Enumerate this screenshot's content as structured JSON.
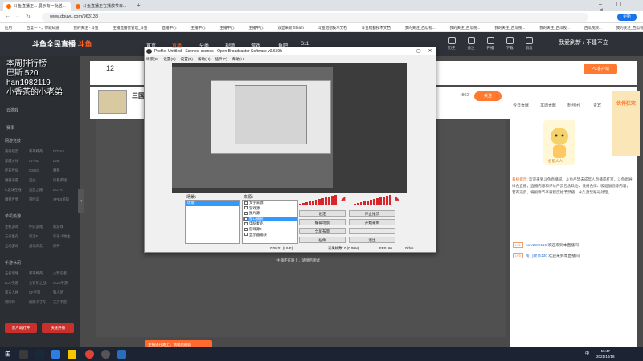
{
  "browser": {
    "tabs": [
      {
        "label": "斗鱼直播正... 展示有一批送..."
      },
      {
        "label": "斗鱼直播正在播放节目..."
      },
      {
        "label": "Steam"
      }
    ],
    "url": "www.douyu.com/963138",
    "update_label": "更新",
    "bookmarks": [
      "应用",
      "百度一下，你就知道",
      "我的关注 - 斗鱼",
      "主播直播营管理_斗鱼",
      "直播中心",
      "主播中心",
      "主播中心",
      "主播中心",
      "双显来斯 Steam",
      "斗鱼给勤技术文档",
      "斗鱼给勤技术文档",
      "我的关注_西瓜视...",
      "我的关注_西瓜视...",
      "我的关注_西瓜视...",
      "我的关注_西瓜视...",
      "西瓜视频...",
      "我的关注_西瓜视频",
      "其他书签"
    ]
  },
  "douyu": {
    "logo_main": "斗鱼全民直播",
    "logo_sub": "斗鱼",
    "nav": [
      "首页",
      "直播",
      "分类",
      "视频",
      "游戏",
      "鱼吧",
      "S11"
    ],
    "icons": [
      {
        "label": "历史",
        "icon": "clock-icon"
      },
      {
        "label": "关注",
        "icon": "heart-icon"
      },
      {
        "label": "开播",
        "icon": "camera-icon"
      },
      {
        "label": "下载",
        "icon": "download-icon"
      },
      {
        "label": "消息",
        "icon": "bell-icon"
      }
    ],
    "user": "我爱刷新 / 不建不立",
    "followers": "12",
    "room_title": "三国",
    "follow_label": "关注",
    "follow_count": "4802",
    "pc_label": "PC客户端",
    "status_text": "主播还在路上，请稍后测试"
  },
  "overlay": {
    "lines": [
      "本周排行榜",
      "巴斯 520",
      "han1982119",
      "小香茶的小老弟"
    ]
  },
  "sidebar": {
    "sections": [
      {
        "title": "网游竞技",
        "items": [
          "英雄联盟",
          "和平精英",
          "DOTA2",
          "穿越火线",
          "CF/HD",
          "DNF",
          "炉石传说",
          "CSGO",
          "魔兽",
          "魔兽争霸",
          "逆战",
          "风暴英雄",
          "fc足球在线",
          "流放之路",
          "DOTA",
          "魔兽世界",
          "冒险岛",
          "APEX英雄"
        ]
      },
      {
        "title": "单机热游",
        "items": [
          "主机游戏",
          "怀旧游戏",
          "新游戏",
          "方舟生存",
          "鬼泣5",
          "欢乐斗地主",
          "互动游戏",
          "战地风云",
          "原神"
        ]
      },
      {
        "title": "手游休闲",
        "items": [
          "王者荣耀",
          "和平精英",
          "火影忍者",
          "LOL手游",
          "金铲铲之战",
          "COD手游",
          "第五人格",
          "CF手游",
          "狼人杀",
          "阴阳师",
          "跑跑卡丁车",
          "天刀手游"
        ]
      }
    ],
    "cloud_label": "云游戏",
    "esports_label": "赛事",
    "btn_left": "客户端打开",
    "btn_right": "快速开播"
  },
  "obs": {
    "title": "Profile: Untitled - Scenes: scenes - Open Broadcaster Software v0.659b",
    "menu": [
      "场景(S)",
      "设置(S)",
      "设置(B)",
      "帮助(H)",
      "插件(P)",
      "帮助(H)"
    ],
    "scenes_label": "场景：",
    "sources_label": "来源：",
    "scenes": [
      "场景"
    ],
    "sources": [
      "文字来源",
      "游戏源",
      "图片源",
      "窗口捕获",
      "电脑麦克",
      "游戏源2",
      "显示器捕获"
    ],
    "buttons": {
      "settings": "设定",
      "stop_stream": "停止推流",
      "edit_scene": "编辑场景",
      "start_record": "开始录制",
      "fullscreen": "全屏布景",
      "plugins": "插件",
      "exit": "退出"
    },
    "status": {
      "time": "0:00:01 (LIVE)",
      "dropped": "丢失帧数: 0 (0.00%)",
      "fps": "FPS: 60",
      "bitrate": "0kb/s"
    }
  },
  "right": {
    "tabs": [
      "今日贡献",
      "本周贡献",
      "粉丝团",
      "贵宾"
    ],
    "announce_title": "系统提示:",
    "announce": "欢迎来到斗鱼直播间。斗鱼严禁未成年人直播或打赏，斗鱼倡导绿色直播，直播内容和评论严禁包含政治、低俗色情、吸烟酗酒等内容，若有违反，将视情节严重程度给予禁播、永久封禁账号处理。",
    "chats": [
      {
        "level": "LV1",
        "name": "han1982119",
        "msg": "欢迎来到本直播间"
      },
      {
        "level": "LV5",
        "name": "南门故事130",
        "msg": "欢迎来到本直播间"
      }
    ],
    "banner": "伙伴狂欢",
    "avatar_caption": "伯爵大人"
  },
  "notice": "主播还在路上，请稍后刷新",
  "clock": {
    "time": "16:47",
    "date": "2021/10/18"
  },
  "tray_lang": "中"
}
